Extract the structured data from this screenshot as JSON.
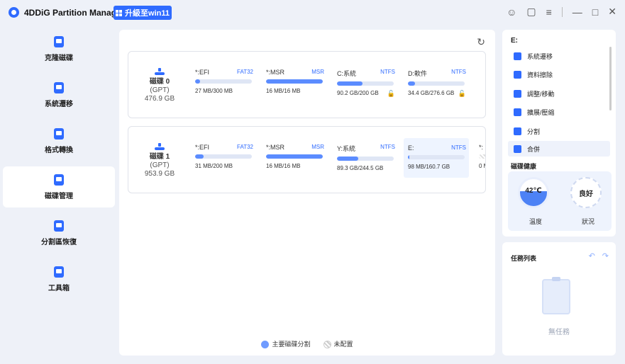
{
  "app": {
    "title": "4DDiG Partition Manager",
    "upgrade_label": "升級至win11"
  },
  "sidebar": {
    "items": [
      {
        "label": "克隆磁碟"
      },
      {
        "label": "系統遷移"
      },
      {
        "label": "格式轉換"
      },
      {
        "label": "磁碟管理"
      },
      {
        "label": "分割區恢復"
      },
      {
        "label": "工具箱"
      }
    ],
    "active_index": 3
  },
  "disks": [
    {
      "name": "磁碟 0",
      "style": "(GPT)",
      "size": "476.9 GB",
      "partitions": [
        {
          "name": "*:EFI",
          "fs": "FAT32",
          "usage": "27 MB/300 MB",
          "fill_ratio": 0.09,
          "locked": false
        },
        {
          "name": "*:MSR",
          "fs": "MSR",
          "usage": "16 MB/16 MB",
          "fill_ratio": 1.0,
          "locked": false
        },
        {
          "name": "C:系統",
          "fs": "NTFS",
          "usage": "90.2 GB/200 GB",
          "fill_ratio": 0.45,
          "locked": true
        },
        {
          "name": "D:軟件",
          "fs": "NTFS",
          "usage": "34.4 GB/276.6 GB",
          "fill_ratio": 0.12,
          "locked": true
        }
      ]
    },
    {
      "name": "磁碟 1",
      "style": "(GPT)",
      "size": "953.9 GB",
      "partitions": [
        {
          "name": "*:EFI",
          "fs": "FAT32",
          "usage": "31 MB/200 MB",
          "fill_ratio": 0.15,
          "locked": false
        },
        {
          "name": "*:MSR",
          "fs": "MSR",
          "usage": "16 MB/16 MB",
          "fill_ratio": 1.0,
          "locked": false
        },
        {
          "name": "Y:系統",
          "fs": "NTFS",
          "usage": "89.3 GB/244.5 GB",
          "fill_ratio": 0.37,
          "locked": false
        },
        {
          "name": "E:",
          "fs": "NTFS",
          "usage": "98 MB/160.7 GB",
          "fill_ratio": 0.01,
          "locked": false,
          "selected": true
        },
        {
          "name": "*:",
          "fs": "",
          "usage": "0 M",
          "fill_ratio": 0,
          "locked": false
        }
      ]
    }
  ],
  "legend": {
    "primary": "主要磁碟分割",
    "unallocated": "未配置"
  },
  "right_panel": {
    "title": "E:",
    "actions": [
      {
        "label": "系統遷移"
      },
      {
        "label": "資料擦除"
      },
      {
        "label": "調整/移動"
      },
      {
        "label": "擴展/壓縮"
      },
      {
        "label": "分割"
      },
      {
        "label": "合併"
      }
    ],
    "health_title": "磁碟健康",
    "temperature_value": "42℃",
    "temperature_label": "溫度",
    "status_value": "良好",
    "status_label": "狀況"
  },
  "task_panel": {
    "title": "任務列表",
    "empty_text": "無任務"
  },
  "colors": {
    "accent": "#2f6bff",
    "bar_fill": "#5b8cff",
    "bar_track": "#dfe6f5"
  }
}
